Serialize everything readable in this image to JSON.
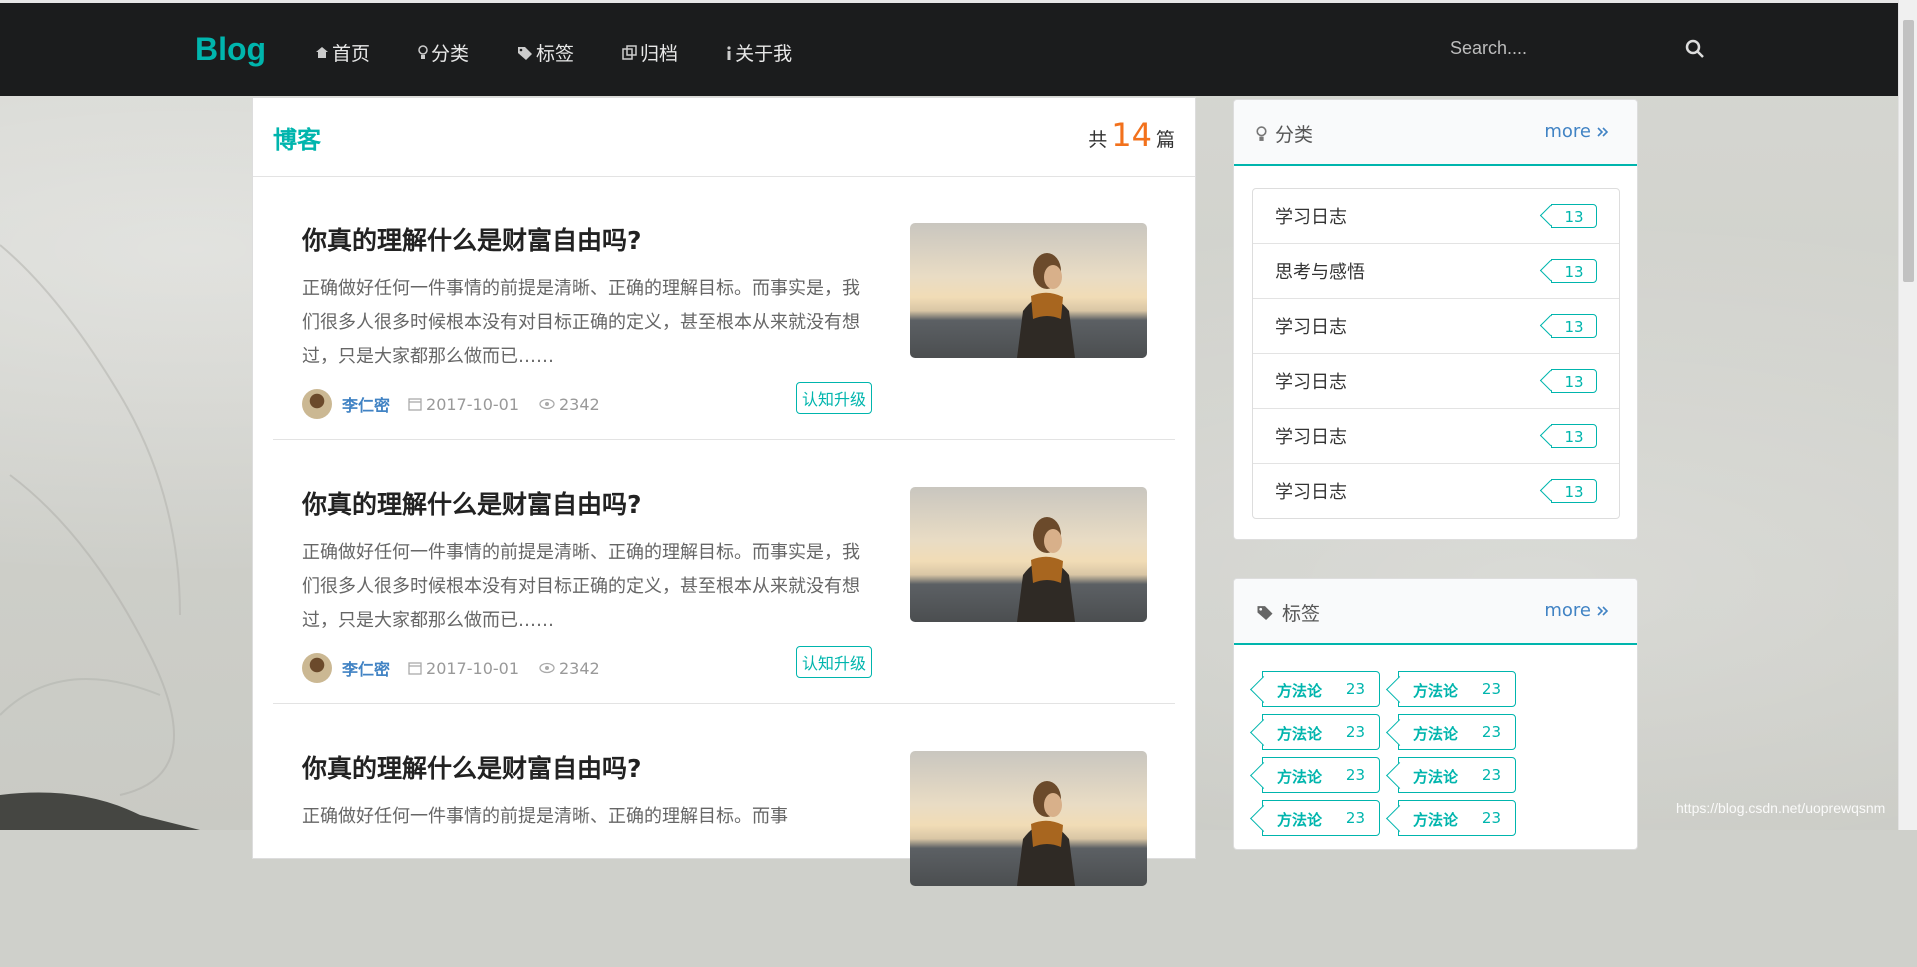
{
  "header": {
    "logo": "Blog",
    "nav": [
      {
        "icon": "home-icon",
        "label": "首页"
      },
      {
        "icon": "lightbulb-icon",
        "label": "分类"
      },
      {
        "icon": "tags-icon",
        "label": "标签"
      },
      {
        "icon": "clone-icon",
        "label": "归档"
      },
      {
        "icon": "info-icon",
        "label": "关于我"
      }
    ],
    "search_placeholder": "Search...."
  },
  "main": {
    "title": "博客",
    "count_prefix": "共",
    "count": "14",
    "count_suffix": "篇",
    "posts": [
      {
        "title": "你真的理解什么是财富自由吗?",
        "desc": "正确做好任何一件事情的前提是清晰、正确的理解目标。而事实是，我们很多人很多时候根本没有对目标正确的定义，甚至根本从来就没有想过，只是大家都那么做而已……",
        "author": "李仁密",
        "date": "2017-10-01",
        "views": "2342",
        "tag": "认知升级"
      },
      {
        "title": "你真的理解什么是财富自由吗?",
        "desc": "正确做好任何一件事情的前提是清晰、正确的理解目标。而事实是，我们很多人很多时候根本没有对目标正确的定义，甚至根本从来就没有想过，只是大家都那么做而已……",
        "author": "李仁密",
        "date": "2017-10-01",
        "views": "2342",
        "tag": "认知升级"
      },
      {
        "title": "你真的理解什么是财富自由吗?",
        "desc": "正确做好任何一件事情的前提是清晰、正确的理解目标。而事",
        "author": "",
        "date": "",
        "views": "",
        "tag": ""
      }
    ]
  },
  "sidebar": {
    "categories": {
      "title": "分类",
      "more": "more",
      "items": [
        {
          "name": "学习日志",
          "count": "13"
        },
        {
          "name": "思考与感悟",
          "count": "13"
        },
        {
          "name": "学习日志",
          "count": "13"
        },
        {
          "name": "学习日志",
          "count": "13"
        },
        {
          "name": "学习日志",
          "count": "13"
        },
        {
          "name": "学习日志",
          "count": "13"
        }
      ]
    },
    "tags": {
      "title": "标签",
      "more": "more",
      "items": [
        {
          "name": "方法论",
          "count": "23"
        },
        {
          "name": "方法论",
          "count": "23"
        },
        {
          "name": "方法论",
          "count": "23"
        },
        {
          "name": "方法论",
          "count": "23"
        },
        {
          "name": "方法论",
          "count": "23"
        },
        {
          "name": "方法论",
          "count": "23"
        },
        {
          "name": "方法论",
          "count": "23"
        },
        {
          "name": "方法论",
          "count": "23"
        }
      ]
    }
  },
  "watermark": "https://blog.csdn.net/uoprewqsnm",
  "colors": {
    "accent": "#00b5ad",
    "link": "#4183c4",
    "count": "#f2711c",
    "header": "#1b1c1d"
  }
}
